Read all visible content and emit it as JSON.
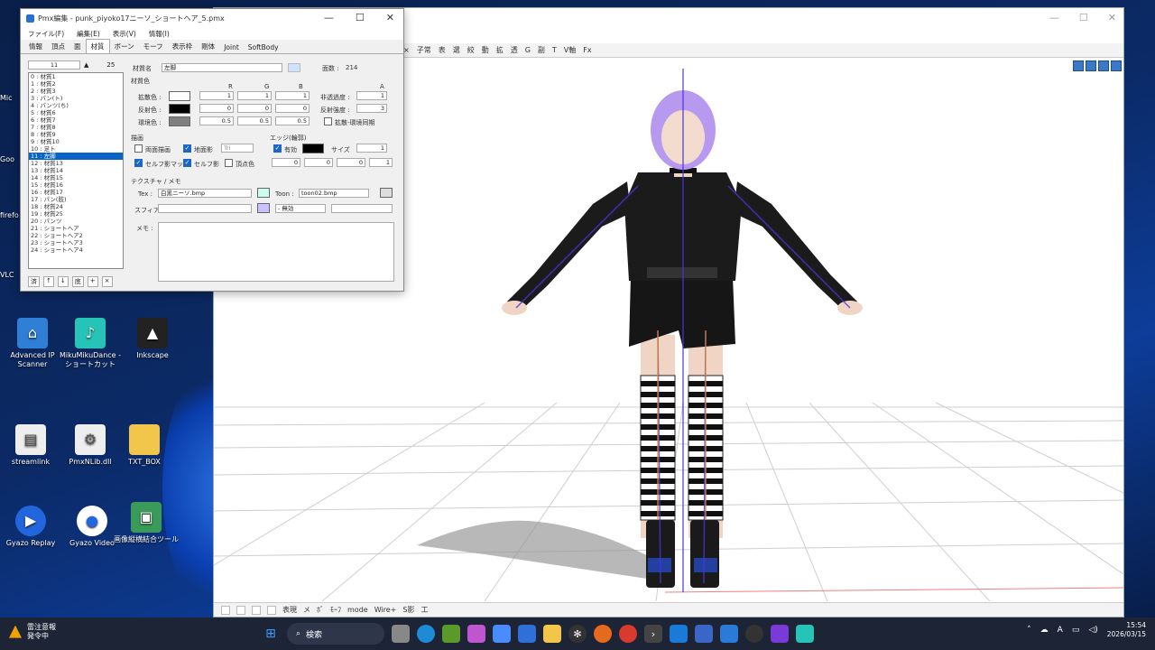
{
  "desktop": {
    "icons": [
      {
        "name": "advanced-ip-scanner",
        "label": "Advanced IP Scanner"
      },
      {
        "name": "mikumikudance-shortcut",
        "label": "MikuMikuDance - ショートカット"
      },
      {
        "name": "inkscape",
        "label": "Inkscape"
      },
      {
        "name": "streamlink",
        "label": "streamlink"
      },
      {
        "name": "pmxnlib",
        "label": "PmxNLib.dll"
      },
      {
        "name": "txt-box",
        "label": "TXT_BOX"
      },
      {
        "name": "gyazo-replay",
        "label": "Gyazo Replay"
      },
      {
        "name": "gyazo-video",
        "label": "Gyazo Video"
      },
      {
        "name": "image-join-tool",
        "label": "画像縦横結合ツール"
      }
    ],
    "left_clipped": [
      "Mic",
      "Goo",
      "firefo",
      "VLC"
    ]
  },
  "editor": {
    "title": "Pmx編集 - punk_piyoko17ニーソ_ショートヘア_5.pmx",
    "menu": [
      "ファイル(F)",
      "編集(E)",
      "表示(V)",
      "情報(I)"
    ],
    "tabs": [
      "情報",
      "頂点",
      "面",
      "材質",
      "ボーン",
      "モーフ",
      "表示枠",
      "剛体",
      "Joint",
      "SoftBody"
    ],
    "active_tab": "材質",
    "list_index_value": "11",
    "list_count": "25",
    "materials": [
      "0 : 材質1",
      "1 : 材質2",
      "2 : 材質3",
      "3 : パン(ト)",
      "4 : パンツ(ち)",
      "5 : 材質6",
      "6 : 材質7",
      "7 : 材質8",
      "8 : 材質9",
      "9 : 材質10",
      "10 : 足ト",
      "11 : 左脚",
      "12 : 材質13",
      "13 : 材質14",
      "14 : 材質15",
      "15 : 材質16",
      "16 : 材質17",
      "17 : パン(肢)",
      "18 : 材質24",
      "19 : 材質25",
      "20 : パンツ",
      "21 : ショートヘア",
      "22 : ショートヘア2",
      "23 : ショートヘア3",
      "24 : ショートヘア4"
    ],
    "selected_index": 11,
    "list_buttons": [
      "済",
      "↑",
      "↓",
      "底",
      "+",
      "×"
    ],
    "material_name_label": "材質名",
    "material_name": "左脚",
    "face_count_label": "面数 :",
    "face_count": "214",
    "material_color_label": "材質色",
    "rgb_headers": [
      "R",
      "G",
      "B",
      "A"
    ],
    "diffuse_label": "拡散色 :",
    "diffuse": [
      "1",
      "1",
      "1"
    ],
    "specular_label": "反射色 :",
    "specular": [
      "0",
      "0",
      "0"
    ],
    "ambient_label": "環境色 :",
    "ambient": [
      "0.5",
      "0.5",
      "0.5"
    ],
    "alpha_label": "非透過度 :",
    "alpha": "1",
    "spec_power_label": "反射強度 :",
    "spec_power": "3",
    "spec_link_label": "拡散-環境同期",
    "render_label": "描画",
    "double_side_label": "両面描画",
    "ground_shadow_label": "地面影",
    "self_shadow_map_label": "セルフ影マップ",
    "self_shadow_label": "セルフ影",
    "vertex_color_label": "頂点色",
    "tri_label": "Tri",
    "edge_label": "エッジ(輪郭)",
    "edge_enabled_label": "有効",
    "edge_size_label": "サイズ",
    "edge_size": "1",
    "edge_rgba": [
      "0",
      "0",
      "0",
      "1"
    ],
    "texture_label": "テクスチャ / メモ",
    "tex_label": "Tex :",
    "tex_value": "白黒ニーソ.bmp",
    "toon_label": "Toon :",
    "toon_value": "toon02.bmp",
    "sphere_label": "スフィア :",
    "sphere_mode": "- 無効",
    "memo_label": "メモ :"
  },
  "viewer": {
    "toolbar_items": [
      "×",
      "子常",
      "表",
      "選",
      "絞",
      "動",
      "拡",
      "透",
      "G",
      "副",
      "T",
      "V軸",
      "Fx"
    ],
    "bottom_items": [
      "表現",
      "メ",
      "ﾎﾞ",
      "ﾓｰﾌ",
      "mode",
      "Wire+",
      "S影",
      "工"
    ]
  },
  "taskbar": {
    "weather_title": "雷注意報",
    "weather_sub": "発令中",
    "search_placeholder": "検索",
    "time": "15:54",
    "date": "2026/03/15"
  },
  "colors": {
    "accent": "#0a64c8",
    "hair": "#b79af0",
    "bone": "#4a35d8",
    "taskbar": "#1c2435"
  }
}
